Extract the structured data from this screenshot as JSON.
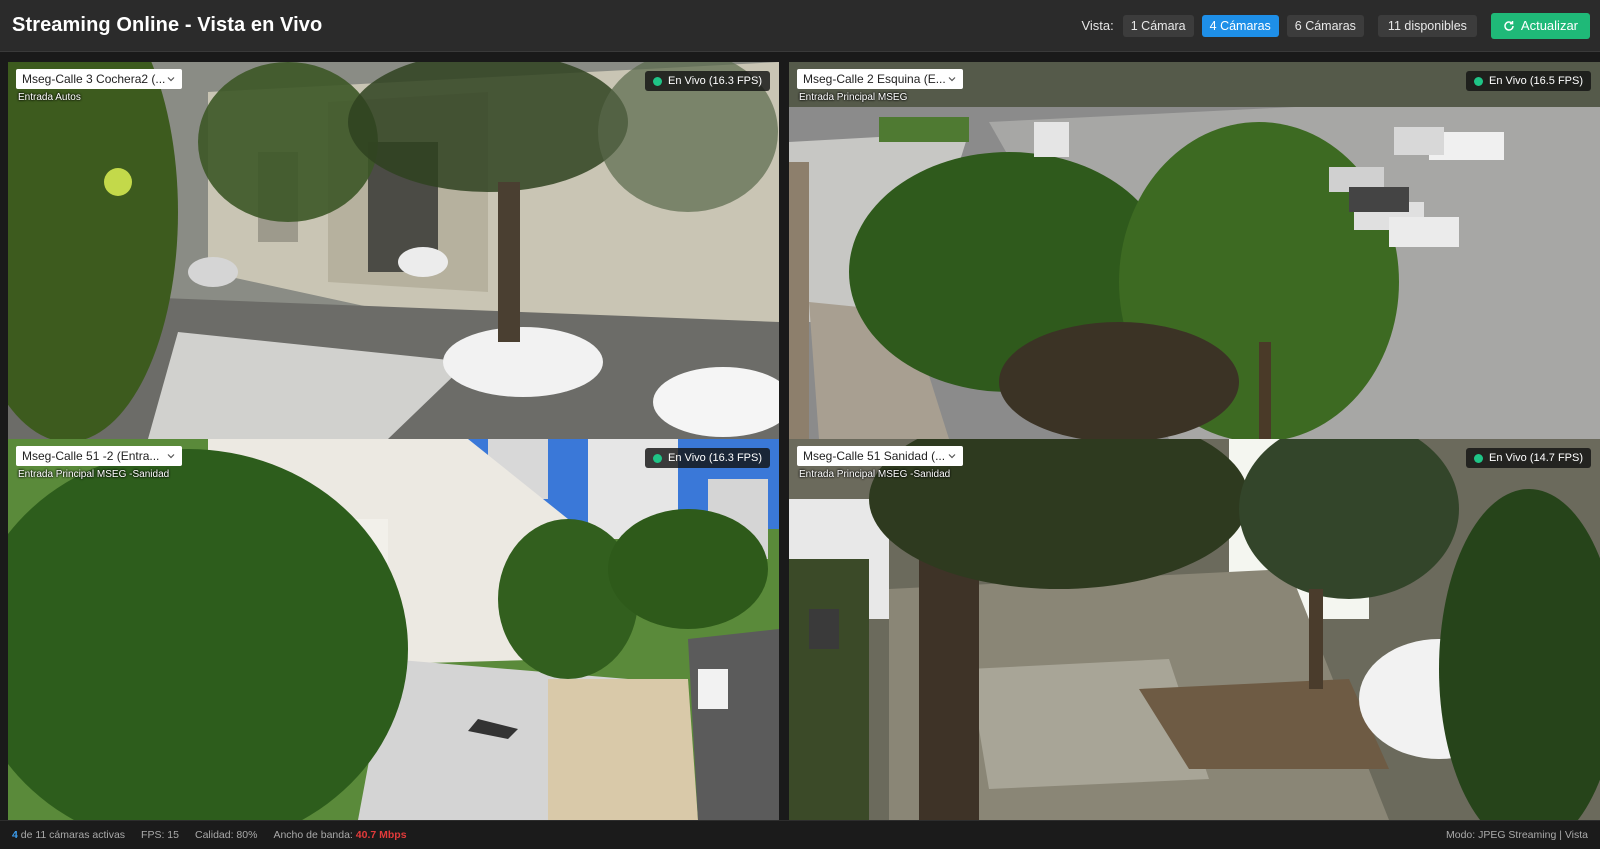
{
  "header": {
    "title": "Streaming Online - Vista en Vivo",
    "vista_label": "Vista:",
    "view_buttons": [
      {
        "label": "1 Cámara",
        "active": false
      },
      {
        "label": "4 Cámaras",
        "active": true
      },
      {
        "label": "6 Cámaras",
        "active": false
      }
    ],
    "available": "11 disponibles",
    "refresh_label": "Actualizar",
    "refresh_icon": "refresh-icon"
  },
  "cameras": [
    {
      "select": "Mseg-Calle 3 Cochera2 (...",
      "subtitle": "Entrada Autos",
      "status": "En Vivo (16.3 FPS)"
    },
    {
      "select": "Mseg-Calle 2 Esquina (E...",
      "subtitle": "Entrada Principal MSEG",
      "status": "En Vivo (16.5 FPS)"
    },
    {
      "select": "Mseg-Calle 51 -2 (Entra...",
      "subtitle": "Entrada Principal MSEG -Sanidad",
      "status": "En Vivo (16.3 FPS)"
    },
    {
      "select": "Mseg-Calle 51 Sanidad (...",
      "subtitle": "Entrada Principal MSEG -Sanidad",
      "status": "En Vivo (14.7 FPS)"
    }
  ],
  "footer": {
    "count": "4",
    "active_text": "de 11 cámaras activas",
    "fps": "FPS: 15",
    "quality": "Calidad: 80%",
    "bandwidth_label": "Ancho de banda:",
    "bandwidth_value": "40.7 Mbps",
    "mode": "Modo: JPEG Streaming | Vista"
  },
  "colors": {
    "accent_blue": "#1e8fe8",
    "refresh_green": "#1fb978",
    "live_dot": "#1fc486",
    "bandwidth_red": "#e23a3a"
  }
}
